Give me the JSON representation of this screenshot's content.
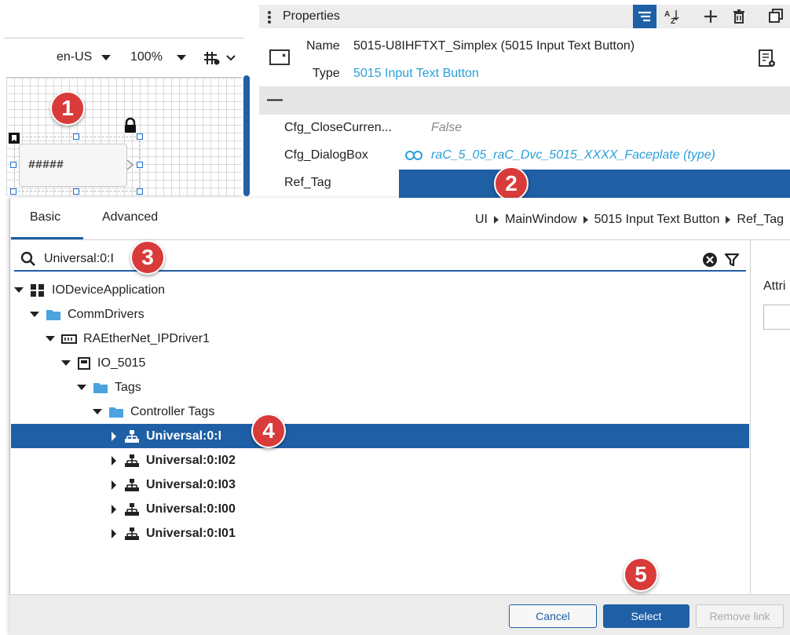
{
  "toolbar": {
    "locale": "en-US",
    "zoom": "100%"
  },
  "canvas": {
    "element_text": "#####"
  },
  "callouts": [
    "1",
    "2",
    "3",
    "4",
    "5"
  ],
  "properties": {
    "title": "Properties",
    "name_label": "Name",
    "name_value": "5015-U8IHFTXT_Simplex (5015 Input Text Button)",
    "type_label": "Type",
    "type_value": "5015 Input Text Button",
    "collapse_symbol": "—",
    "rows": [
      {
        "label": "Cfg_CloseCurren...",
        "value": "False"
      },
      {
        "label": "Cfg_DialogBox",
        "value": "raC_5_05_raC_Dvc_5015_XXXX_Faceplate (type)"
      },
      {
        "label": "Ref_Tag",
        "value": ""
      }
    ]
  },
  "dialog": {
    "tabs": [
      "Basic",
      "Advanced"
    ],
    "breadcrumb": [
      "UI",
      "MainWindow",
      "5015 Input Text Button",
      "Ref_Tag"
    ],
    "search_value": "Universal:0:I",
    "tree": [
      {
        "label": "IODeviceApplication"
      },
      {
        "label": "CommDrivers"
      },
      {
        "label": "RAEtherNet_IPDriver1"
      },
      {
        "label": "IO_5015"
      },
      {
        "label": "Tags"
      },
      {
        "label": "Controller Tags"
      },
      {
        "label": "Universal:0:I"
      },
      {
        "label": "Universal:0:I02"
      },
      {
        "label": "Universal:0:I03"
      },
      {
        "label": "Universal:0:I00"
      },
      {
        "label": "Universal:0:I01"
      }
    ],
    "right_pane_label": "Attri",
    "buttons": {
      "cancel": "Cancel",
      "select": "Select",
      "remove": "Remove link"
    }
  },
  "colors": {
    "accent": "#1f5fa6",
    "link": "#2a9fd8",
    "callout": "#d93a3a"
  }
}
